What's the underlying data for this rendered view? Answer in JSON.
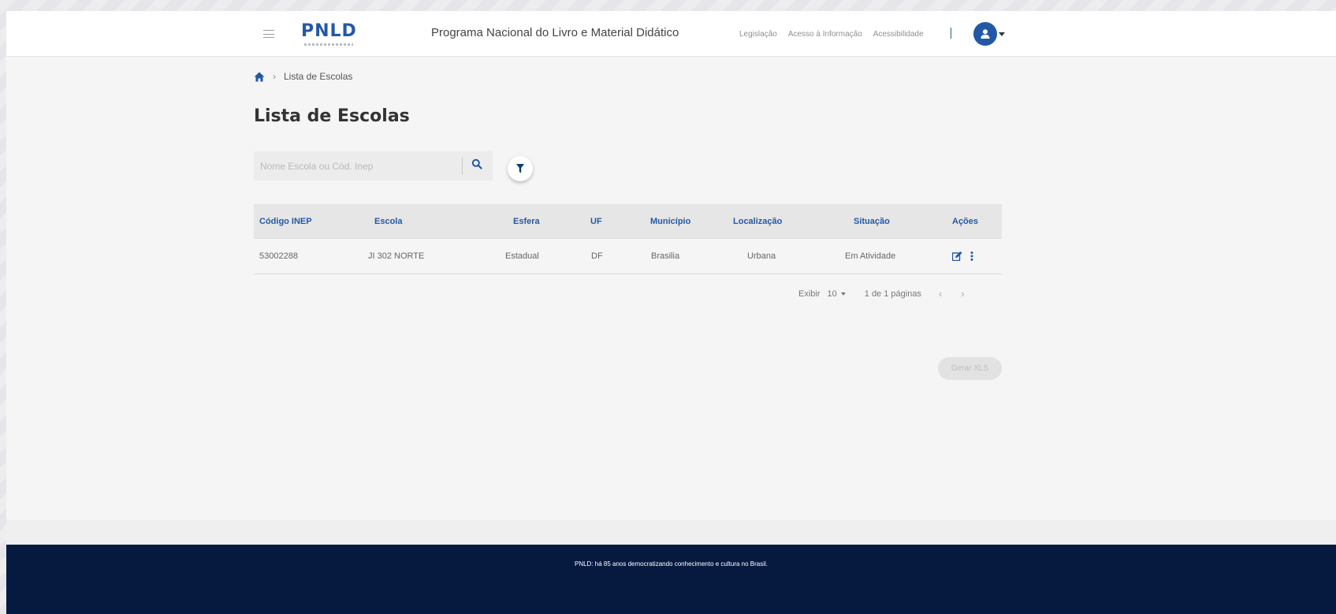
{
  "header": {
    "logo_text": "PNLD",
    "title": "Programa Nacional do Livro e Material Didático",
    "nav_links": [
      "Legislação",
      "Acesso à Informação",
      "Acessibilidade"
    ],
    "brand_color": "#2458a6"
  },
  "breadcrumb": {
    "home_icon": "home-icon",
    "current": "Lista de Escolas"
  },
  "page": {
    "title": "Lista de Escolas"
  },
  "search": {
    "placeholder": "Nome Escola ou Cód. Inep",
    "value": ""
  },
  "table": {
    "columns": [
      "Código INEP",
      "Escola",
      "Esfera",
      "UF",
      "Município",
      "Localização",
      "Situação",
      "Ações"
    ],
    "rows": [
      [
        "53002288",
        "JI 302 NORTE",
        "Estadual",
        "DF",
        "Brasilia",
        "Urbana",
        "Em Atividade"
      ]
    ]
  },
  "pagination": {
    "show_label": "Exibir",
    "per_page": "10",
    "pages_label": "1 de 1 páginas",
    "prev": "‹",
    "next": "›"
  },
  "export": {
    "button_label": "Gerar XLS"
  },
  "footer": {
    "text": "PNLD: há 85 anos democratizando conhecimento e cultura no Brasil."
  }
}
